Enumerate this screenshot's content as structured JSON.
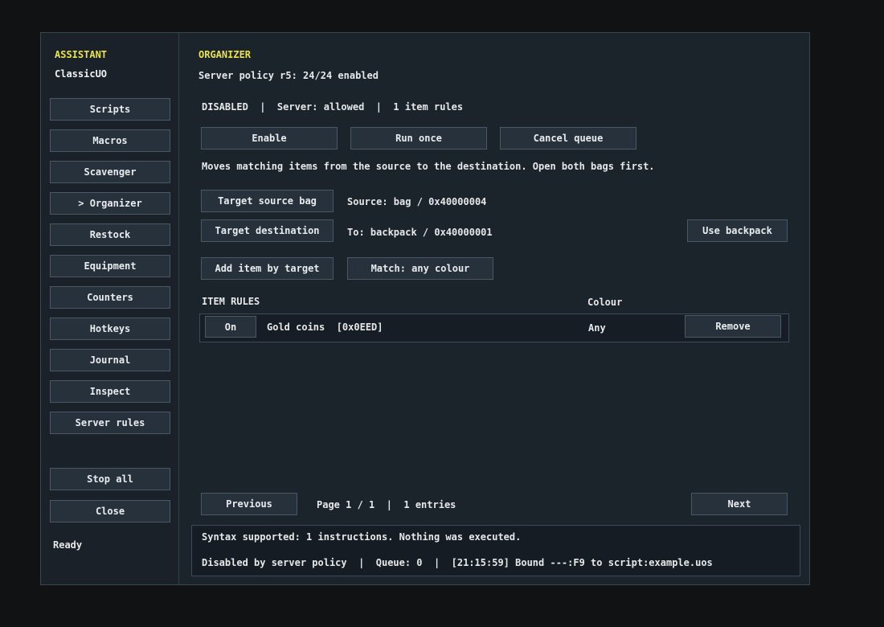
{
  "sidebar": {
    "title": "ASSISTANT",
    "subtitle": "ClassicUO",
    "items": [
      {
        "label": "Scripts"
      },
      {
        "label": "Macros"
      },
      {
        "label": "Scavenger"
      },
      {
        "label": "> Organizer"
      },
      {
        "label": "Restock"
      },
      {
        "label": "Equipment"
      },
      {
        "label": "Counters"
      },
      {
        "label": "Hotkeys"
      },
      {
        "label": "Journal"
      },
      {
        "label": "Inspect"
      },
      {
        "label": "Server rules"
      }
    ],
    "stop_all_label": "Stop all",
    "close_label": "Close",
    "status": "Ready"
  },
  "main": {
    "title": "ORGANIZER",
    "policy": "Server policy r5: 24/24 enabled",
    "status_line": "DISABLED  |  Server: allowed  |  1 item rules",
    "buttons": {
      "enable": "Enable",
      "run_once": "Run once",
      "cancel_queue": "Cancel queue",
      "target_source": "Target source bag",
      "target_destination": "Target destination",
      "use_backpack": "Use backpack",
      "add_item": "Add item by target",
      "match_colour": "Match: any colour"
    },
    "description": "Moves matching items from the source to the destination. Open both bags first.",
    "source_text": "Source: bag / 0x40000004",
    "destination_text": "To: backpack / 0x40000001",
    "rules_heading": "ITEM RULES",
    "colour_heading": "Colour",
    "rules": [
      {
        "toggle": "On",
        "name": "Gold coins  [0x0EED]",
        "colour": "Any",
        "remove": "Remove"
      }
    ],
    "pager": {
      "previous": "Previous",
      "info": "Page 1 / 1  |  1 entries",
      "next": "Next"
    },
    "log": {
      "line1": "Syntax supported: 1 instructions. Nothing was executed.",
      "line2": "Disabled by server policy  |  Queue: 0  |  [21:15:59] Bound ---:F9 to script:example.uos"
    }
  },
  "colors": {
    "accent": "#e9e34a",
    "background": "#1b222a",
    "button": "#27313b"
  }
}
